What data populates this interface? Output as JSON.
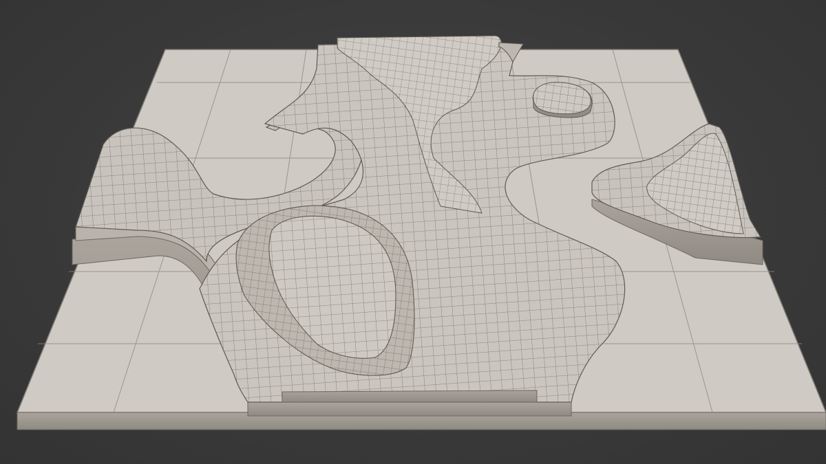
{
  "scene": {
    "subject": "3d-terrain-model",
    "render_style": "wireframe-over-shaded",
    "colors": {
      "background": "#3a3a3a",
      "surface": "#c9c4bd",
      "surface_light": "#d6d1ca",
      "side_face": "#b1aba3",
      "edge_shadow": "#8a857e",
      "wire": "#5a5650",
      "tile_line": "#8d8880"
    }
  }
}
